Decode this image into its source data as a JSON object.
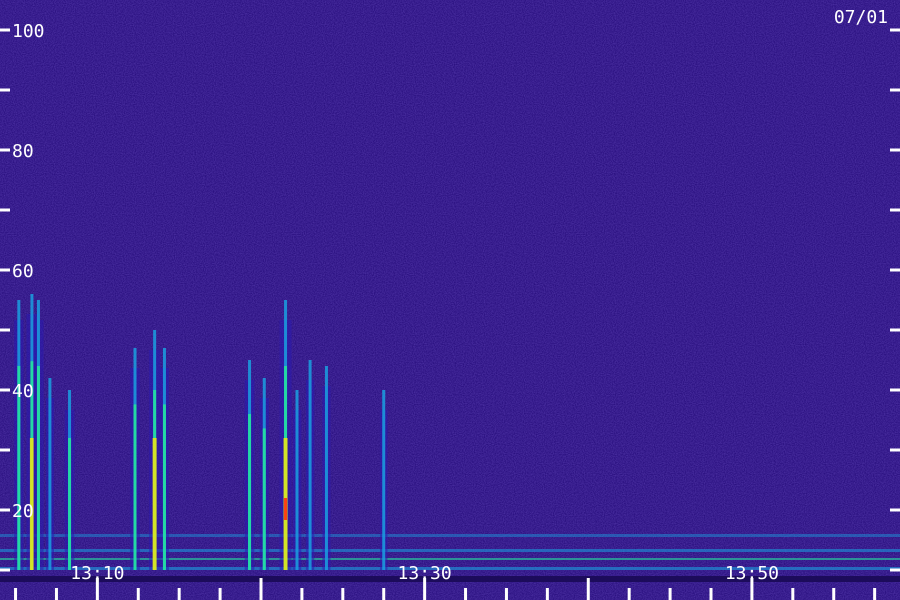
{
  "chart_data": {
    "type": "heatmap",
    "title": "",
    "date_label": "07/01",
    "xlabel": "",
    "ylabel": "",
    "ylim": [
      0,
      100
    ],
    "y_ticks": [
      {
        "value": 100,
        "label": "100"
      },
      {
        "value": 90,
        "label": ""
      },
      {
        "value": 80,
        "label": "80"
      },
      {
        "value": 70,
        "label": ""
      },
      {
        "value": 60,
        "label": "60"
      },
      {
        "value": 50,
        "label": ""
      },
      {
        "value": 40,
        "label": "40"
      },
      {
        "value": 30,
        "label": ""
      },
      {
        "value": 20,
        "label": "20"
      },
      {
        "value": 10,
        "label": ""
      }
    ],
    "x_range_minutes": [
      "13:04",
      "13:59"
    ],
    "x_major_ticks": [
      "13:10",
      "13:20",
      "13:30",
      "13:40",
      "13:50"
    ],
    "x_tick_labels": [
      "13:10",
      "13:30",
      "13:50"
    ],
    "colormap": [
      "#1a0a55",
      "#2a1ab0",
      "#1aa0e0",
      "#25e0a0",
      "#e6e61a",
      "#ff3010"
    ],
    "background_color": "#2a1080",
    "events": [
      {
        "time": "13:05.2",
        "top": 55,
        "intensity": 0.55
      },
      {
        "time": "13:06.0",
        "top": 56,
        "intensity": 0.8
      },
      {
        "time": "13:06.4",
        "top": 55,
        "intensity": 0.7
      },
      {
        "time": "13:07.1",
        "top": 42,
        "intensity": 0.35
      },
      {
        "time": "13:08.3",
        "top": 40,
        "intensity": 0.6
      },
      {
        "time": "13:12.3",
        "top": 47,
        "intensity": 0.65
      },
      {
        "time": "13:13.5",
        "top": 50,
        "intensity": 0.85
      },
      {
        "time": "13:14.1",
        "top": 47,
        "intensity": 0.5
      },
      {
        "time": "13:19.3",
        "top": 45,
        "intensity": 0.6
      },
      {
        "time": "13:20.2",
        "top": 42,
        "intensity": 0.55
      },
      {
        "time": "13:21.5",
        "top": 55,
        "intensity": 1.0
      },
      {
        "time": "13:22.2",
        "top": 40,
        "intensity": 0.45
      },
      {
        "time": "13:23.0",
        "top": 45,
        "intensity": 0.4
      },
      {
        "time": "13:24.0",
        "top": 44,
        "intensity": 0.35
      },
      {
        "time": "13:27.5",
        "top": 40,
        "intensity": 0.25
      }
    ]
  }
}
